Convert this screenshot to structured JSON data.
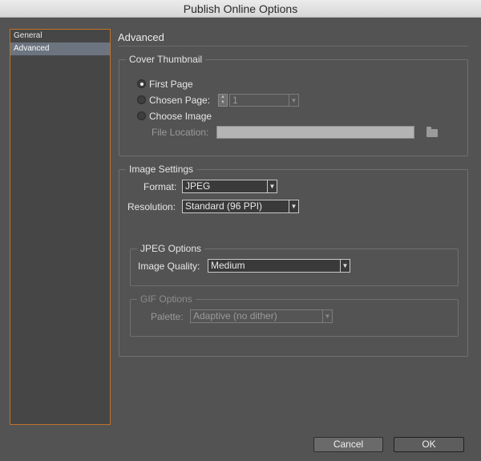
{
  "window": {
    "title": "Publish Online Options"
  },
  "sidebar": {
    "items": [
      {
        "label": "General"
      },
      {
        "label": "Advanced"
      }
    ]
  },
  "main": {
    "title": "Advanced",
    "cover": {
      "legend": "Cover Thumbnail",
      "first_page": "First Page",
      "chosen_page": "Chosen Page:",
      "chosen_page_value": "1",
      "choose_image": "Choose Image",
      "file_location": "File Location:"
    },
    "image": {
      "legend": "Image Settings",
      "format_label": "Format:",
      "format_value": "JPEG",
      "resolution_label": "Resolution:",
      "resolution_value": "Standard (96 PPI)",
      "jpeg": {
        "legend": "JPEG Options",
        "quality_label": "Image Quality:",
        "quality_value": "Medium"
      },
      "gif": {
        "legend": "GIF Options",
        "palette_label": "Palette:",
        "palette_value": "Adaptive (no dither)"
      }
    }
  },
  "footer": {
    "cancel": "Cancel",
    "ok": "OK"
  }
}
